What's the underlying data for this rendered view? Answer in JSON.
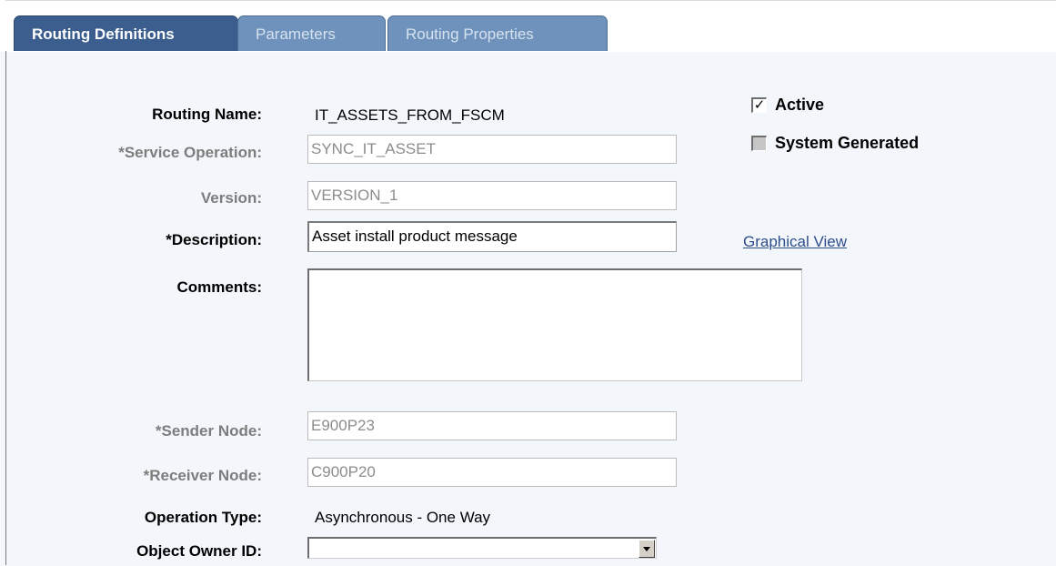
{
  "tabs": [
    {
      "label": "Routing Definitions",
      "active": true
    },
    {
      "label": "Parameters",
      "active": false
    },
    {
      "label": "Routing Properties",
      "active": false
    }
  ],
  "form": {
    "routing_name": {
      "label": "Routing Name:",
      "value": "IT_ASSETS_FROM_FSCM"
    },
    "service_operation": {
      "label": "*Service Operation:",
      "value": "SYNC_IT_ASSET"
    },
    "version": {
      "label": "Version:",
      "value": "VERSION_1"
    },
    "description": {
      "label": "*Description:",
      "value": "Asset install product message"
    },
    "comments": {
      "label": "Comments:",
      "value": ""
    },
    "sender_node": {
      "label": "*Sender Node:",
      "value": "E900P23"
    },
    "receiver_node": {
      "label": "*Receiver Node:",
      "value": "C900P20"
    },
    "operation_type": {
      "label": "Operation Type:",
      "value": "Asynchronous - One Way"
    },
    "object_owner_id": {
      "label": "Object Owner ID:",
      "value": ""
    }
  },
  "checkboxes": {
    "active": {
      "label": "Active",
      "checked": true,
      "mark": "✓"
    },
    "system_generated": {
      "label": "System Generated",
      "checked": false
    }
  },
  "links": {
    "graphical_view": "Graphical View"
  },
  "colors": {
    "panel_bg": "#f3f7fb",
    "active_tab": "#3b5e8e",
    "inactive_tab": "#6e92bb",
    "link": "#2d4d8b"
  }
}
